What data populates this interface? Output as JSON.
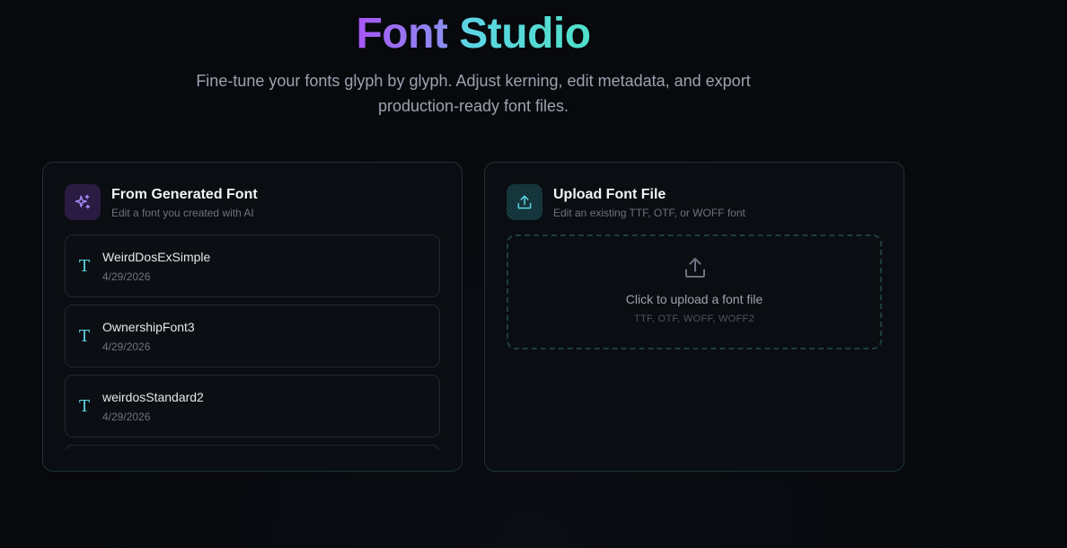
{
  "hero": {
    "title_part1": "Font",
    "title_part2": "Studio",
    "subtitle": "Fine-tune your fonts glyph by glyph. Adjust kerning, edit metadata, and export production-ready font files."
  },
  "generated": {
    "icon": "sparkles-icon",
    "title": "From Generated Font",
    "description": "Edit a font you created with AI",
    "fonts": [
      {
        "name": "WeirdDosExSimple",
        "date": "4/29/2026"
      },
      {
        "name": "OwnershipFont3",
        "date": "4/29/2026"
      },
      {
        "name": "weirdosStandard2",
        "date": "4/29/2026"
      },
      {
        "name": "",
        "date": ""
      }
    ]
  },
  "upload": {
    "icon": "upload-icon",
    "title": "Upload Font File",
    "description": "Edit an existing TTF, OTF, or WOFF font",
    "dropzone_text": "Click to upload a font file",
    "dropzone_formats": "TTF, OTF, WOFF, WOFF2"
  },
  "colors": {
    "accent_purple": "#a855f7",
    "accent_teal": "#5ed3e6",
    "background": "#07090d"
  }
}
